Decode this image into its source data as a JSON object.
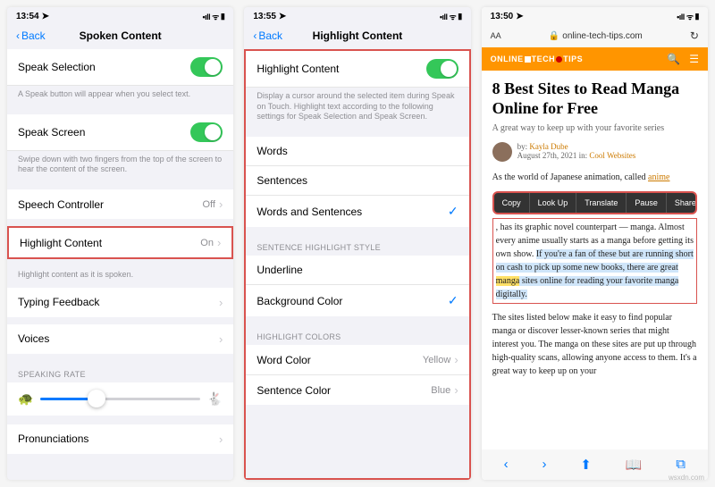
{
  "screen1": {
    "time": "13:54",
    "signal": "•ıll",
    "wifi": "ᯤ",
    "battery": "▮",
    "back": "Back",
    "title": "Spoken Content",
    "speakSelection": {
      "label": "Speak Selection",
      "footer": "A Speak button will appear when you select text."
    },
    "speakScreen": {
      "label": "Speak Screen",
      "footer": "Swipe down with two fingers from the top of the screen to hear the content of the screen."
    },
    "speechController": {
      "label": "Speech Controller",
      "value": "Off"
    },
    "highlightContent": {
      "label": "Highlight Content",
      "value": "On",
      "footer": "Highlight content as it is spoken."
    },
    "typingFeedback": {
      "label": "Typing Feedback"
    },
    "voices": {
      "label": "Voices"
    },
    "speakingRate": {
      "header": "SPEAKING RATE"
    },
    "pronunciations": {
      "label": "Pronunciations"
    }
  },
  "screen2": {
    "time": "13:55",
    "back": "Back",
    "title": "Highlight Content",
    "highlightContent": {
      "label": "Highlight Content",
      "footer": "Display a cursor around the selected item during Speak on Touch. Highlight text according to the following settings for Speak Selection and Speak Screen."
    },
    "words": "Words",
    "sentences": "Sentences",
    "wordsAndSentences": "Words and Sentences",
    "styleHeader": "SENTENCE HIGHLIGHT STYLE",
    "underline": "Underline",
    "backgroundColor": "Background Color",
    "colorsHeader": "HIGHLIGHT COLORS",
    "wordColor": {
      "label": "Word Color",
      "value": "Yellow"
    },
    "sentenceColor": {
      "label": "Sentence Color",
      "value": "Blue"
    }
  },
  "screen3": {
    "time": "13:50",
    "textSize": "AA",
    "lock": "🔒",
    "url": "online-tech-tips.com",
    "logo": [
      "ONLINE",
      "TECH",
      "TIPS"
    ],
    "article": {
      "title": "8 Best Sites to Read Manga Online for Free",
      "subtitle": "A great way to keep up with your favorite series",
      "byline_by": "by:",
      "author": "Kayla Dube",
      "date": "August 27th, 2021 in:",
      "category": "Cool Websites",
      "p1_a": "As the world of Japanese animation, called ",
      "p1_link": "anime",
      "p1_b": ", has its graphic novel counterpart — manga. Almost every anime usually starts as a manga before getting its own show. ",
      "p1_hl": "If you're a fan of these but are running short on cash to pick up some new books, there are great ",
      "p1_word": "manga",
      "p1_hl2": " sites online for reading your favorite manga digitally.",
      "p2": "The sites listed below make it easy to find popular manga or discover lesser-known series that might interest you. The manga on these sites are put up through high-quality scans, allowing anyone access to them. It's a great way to keep up on your"
    },
    "menu": [
      "Copy",
      "Look Up",
      "Translate",
      "Pause",
      "Share…"
    ]
  },
  "watermark": "wsxdn.com"
}
